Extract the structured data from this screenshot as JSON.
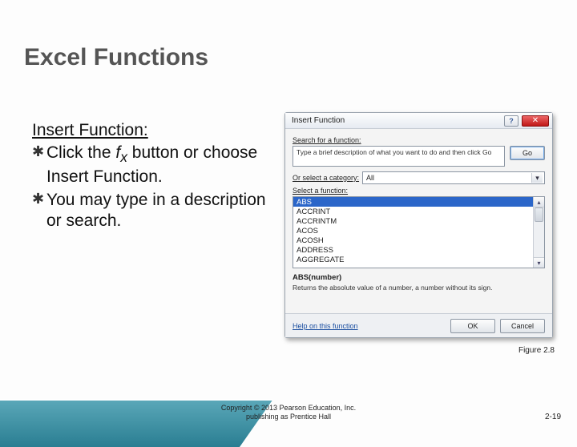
{
  "slide": {
    "title": "Excel Functions",
    "subhead": "Insert Function:",
    "bullets": [
      "Click the f_x button or choose Insert Function.",
      "You may type in a description or search."
    ],
    "caption": "Figure 2.8",
    "copyright_l1": "Copyright © 2013 Pearson Education, Inc.",
    "copyright_l2": "publishing as Prentice Hall",
    "page_num": "2-19"
  },
  "dialog": {
    "title": "Insert Function",
    "help_glyph": "?",
    "close_glyph": "✕",
    "search_label": "Search for a function:",
    "search_value": "Type a brief description of what you want to do and then click Go",
    "go_label": "Go",
    "category_label_pre": "Or select a ",
    "category_label_u": "c",
    "category_label_post": "ategory:",
    "category_value": "All",
    "select_label": "Select a function:",
    "functions": [
      "ABS",
      "ACCRINT",
      "ACCRINTM",
      "ACOS",
      "ACOSH",
      "ADDRESS",
      "AGGREGATE"
    ],
    "selected_index": 0,
    "syntax": "ABS(number)",
    "description": "Returns the absolute value of a number, a number without its sign.",
    "help_link": "Help on this function",
    "ok_label": "OK",
    "cancel_label": "Cancel"
  }
}
